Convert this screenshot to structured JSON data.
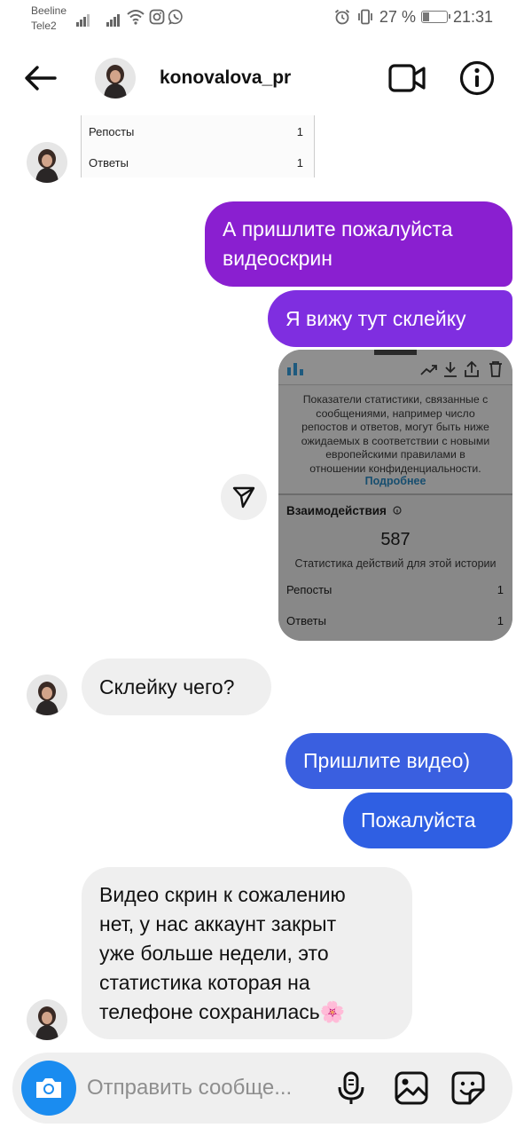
{
  "status_bar": {
    "carrier_1": "Beeline",
    "carrier_2": "Tele2",
    "battery": "27 %",
    "battery_level": 0.27,
    "time": "21:31"
  },
  "header": {
    "username": "konovalova_pr"
  },
  "quoted_stats": {
    "rows": [
      {
        "label": "Репосты",
        "value": "1"
      },
      {
        "label": "Ответы",
        "value": "1"
      }
    ]
  },
  "messages": [
    {
      "from": "me",
      "text_line_1": "А пришлите пожалуйста",
      "text_line_2": "видеоскрин"
    },
    {
      "from": "me",
      "text": "Я вижу тут склейку"
    },
    {
      "from": "them",
      "text": "Склейку чего?"
    },
    {
      "from": "me",
      "text": "Пришлите видео)"
    },
    {
      "from": "me",
      "text": "Пожалуйста"
    },
    {
      "from": "them",
      "lines": [
        "Видео скрин к сожалению",
        "нет, у нас аккаунт закрыт",
        "уже больше недели, это",
        "статистика которая на",
        "телефоне сохранилась🌸"
      ]
    }
  ],
  "shared_image": {
    "notice_lines": [
      "Показатели статистики, связанные с",
      "сообщениями, например число",
      "репостов и ответов, могут быть ниже",
      "ожидаемых в соответствии с новыми",
      "европейскими правилами в",
      "отношении конфиденциальности."
    ],
    "more_link": "Подробнее",
    "section_title": "Взаимодействия",
    "total": "587",
    "caption": "Статистика действий для этой истории",
    "rows": [
      {
        "label": "Репосты",
        "value": "1"
      },
      {
        "label": "Ответы",
        "value": "1"
      }
    ]
  },
  "composer": {
    "placeholder": "Отправить сообще..."
  },
  "colors": {
    "bubble_purple": "#8a1fd0",
    "bubble_violet": "#7f2ee0",
    "bubble_blue": "#3a5fe0",
    "bubble_incoming": "#efefef",
    "camera_blue": "#1a8cf0"
  },
  "icons": [
    "back-arrow-icon",
    "video-call-icon",
    "info-icon",
    "share-icon",
    "camera-icon",
    "microphone-icon",
    "gallery-icon",
    "sticker-icon",
    "wifi-icon",
    "instagram-icon",
    "whatsapp-icon",
    "alarm-icon",
    "vibrate-icon"
  ]
}
